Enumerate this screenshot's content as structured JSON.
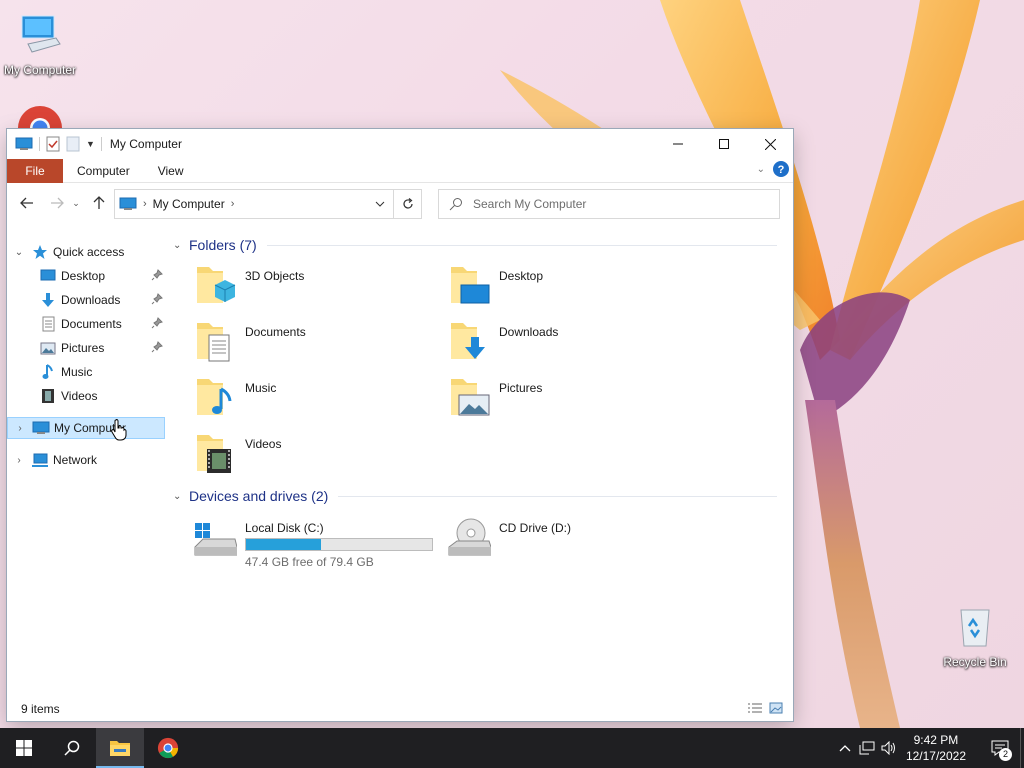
{
  "desktop": {
    "icons": [
      {
        "label": "My Computer",
        "icon": "computer-icon"
      },
      {
        "label": "Recycle Bin",
        "icon": "recycle-bin-icon"
      }
    ]
  },
  "window": {
    "title": "My Computer",
    "ribbon_tabs": [
      "File",
      "Computer",
      "View"
    ],
    "address": {
      "path": "My Computer"
    },
    "search": {
      "placeholder": "Search My Computer"
    },
    "nav": {
      "quick_access": "Quick access",
      "quick_items": [
        "Desktop",
        "Downloads",
        "Documents",
        "Pictures",
        "Music",
        "Videos"
      ],
      "my_computer": "My Computer",
      "network": "Network"
    },
    "content": {
      "folders_header": "Folders (7)",
      "folders": [
        "3D Objects",
        "Desktop",
        "Documents",
        "Downloads",
        "Music",
        "Pictures",
        "Videos"
      ],
      "drives_header": "Devices and drives (2)",
      "drives": [
        {
          "name": "Local Disk (C:)",
          "free_text": "47.4 GB free of 79.4 GB",
          "used_fraction": 0.403
        },
        {
          "name": "CD Drive (D:)"
        }
      ]
    },
    "status": {
      "items": "9 items"
    }
  },
  "taskbar": {
    "time": "9:42 PM",
    "date": "12/17/2022",
    "notification_count": "2"
  },
  "colors": {
    "accent": "#26a0da",
    "file_tab": "#b9472a",
    "selection": "#cce8ff",
    "taskbar": "#1f1f22"
  }
}
